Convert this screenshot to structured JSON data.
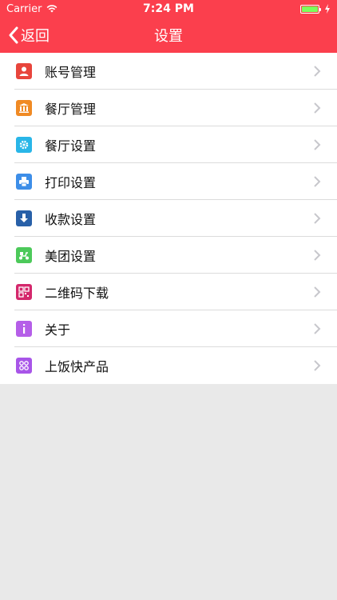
{
  "status": {
    "carrier": "Carrier",
    "time": "7:24 PM"
  },
  "nav": {
    "back": "返回",
    "title": "设置"
  },
  "menu": [
    {
      "label": "账号管理",
      "color": "#e8453c",
      "icon": "person-icon"
    },
    {
      "label": "餐厅管理",
      "color": "#f08a24",
      "icon": "building-icon"
    },
    {
      "label": "餐厅设置",
      "color": "#29b6e8",
      "icon": "gear-icon"
    },
    {
      "label": "打印设置",
      "color": "#3d8ee8",
      "icon": "printer-icon"
    },
    {
      "label": "收款设置",
      "color": "#2860a8",
      "icon": "download-icon"
    },
    {
      "label": "美团设置",
      "color": "#4cc95a",
      "icon": "scooter-icon"
    },
    {
      "label": "二维码下载",
      "color": "#d4286c",
      "icon": "qrcode-icon"
    },
    {
      "label": "关于",
      "color": "#b55ee8",
      "icon": "info-icon"
    },
    {
      "label": "上饭快产品",
      "color": "#a855e8",
      "icon": "apps-icon"
    }
  ]
}
